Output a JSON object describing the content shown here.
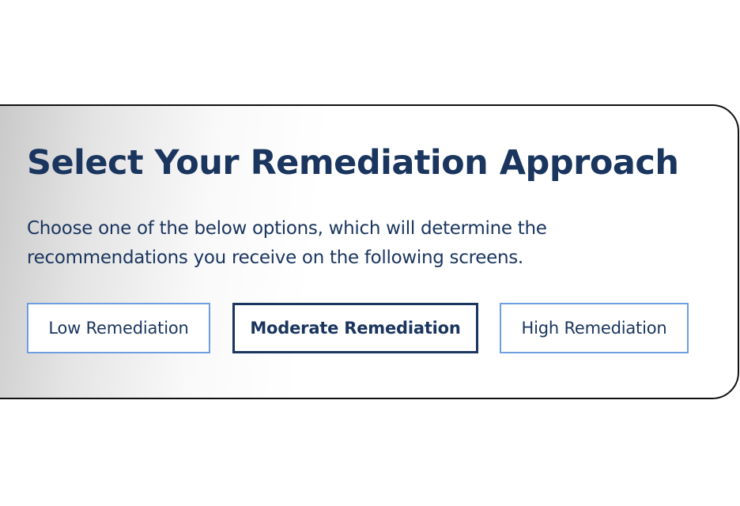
{
  "panel": {
    "title": "Select Your Remediation Approach",
    "description": "Choose one of the below options, which will determine the recommendations you receive on the following screens."
  },
  "options": [
    {
      "label": "Low Remediation",
      "selected": false
    },
    {
      "label": "Moderate Remediation",
      "selected": true
    },
    {
      "label": "High Remediation",
      "selected": false
    }
  ],
  "colors": {
    "heading_text": "#1a355e",
    "selected_border": "#1a355e",
    "unselected_border": "#6f9ee0",
    "card_border": "#111111"
  }
}
